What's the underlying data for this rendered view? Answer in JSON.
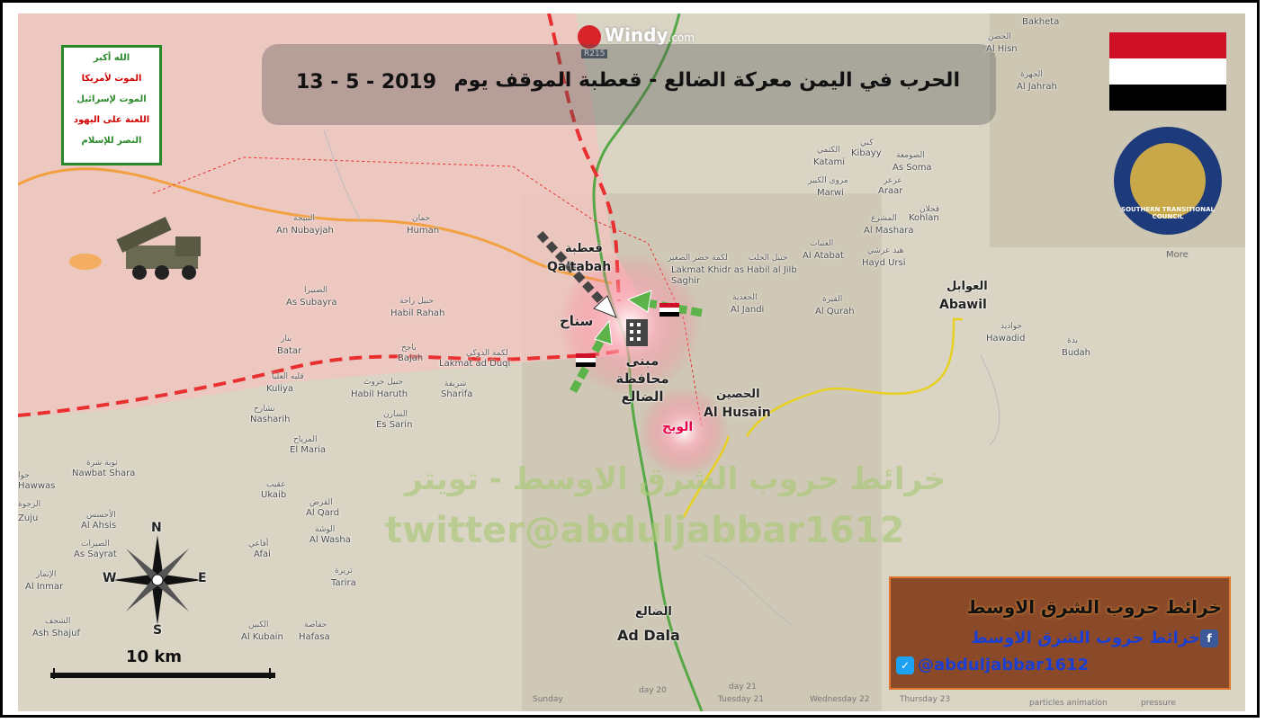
{
  "title": {
    "text": "الحرب في اليمن معركة الضالع - قعطبة الموقف يوم",
    "date": "13 - 5 - 2019"
  },
  "windy": {
    "brand": "Windy",
    "suffix": ".com",
    "road": "R215"
  },
  "slogan": [
    "الله أكبر",
    "الموت لأمريكا",
    "الموت لإسرائيل",
    "اللعنة على اليهود",
    "النصر للإسلام"
  ],
  "stc": {
    "label": "SOUTHERN TRANSITIONAL COUNCIL",
    "more": "More"
  },
  "flag_colors": [
    "#ce1126",
    "#ffffff",
    "#000000"
  ],
  "places": [
    {
      "en": "An Nubayjah",
      "ar": "النبيجة"
    },
    {
      "en": "Human",
      "ar": "حمان"
    },
    {
      "en": "Qa'tabah",
      "ar": "قعطبة"
    },
    {
      "en": "As Subayra",
      "ar": "الصبيرا"
    },
    {
      "en": "Habil Rahah",
      "ar": "حبيل راحة"
    },
    {
      "en": "Batar",
      "ar": "بتار"
    },
    {
      "en": "Bajah",
      "ar": "باجح"
    },
    {
      "en": "Lakmat ad Duqi",
      "ar": "لكمة الدوكي"
    },
    {
      "en": "Kuliya",
      "ar": "قليه العليا"
    },
    {
      "en": "Habil Haruth",
      "ar": "حبيل حروث"
    },
    {
      "en": "Sharifa",
      "ar": "شريفة"
    },
    {
      "en": "Nasharih",
      "ar": "نشارح"
    },
    {
      "en": "Es Sarin",
      "ar": "السارن"
    },
    {
      "en": "El Maria",
      "ar": "المرياح"
    },
    {
      "en": "Nawbat Shara",
      "ar": "نوبة شرة"
    },
    {
      "en": "Ukaib",
      "ar": "عقيب"
    },
    {
      "en": "Al Qard",
      "ar": "القرض"
    },
    {
      "en": "Al Washa",
      "ar": "الوشة"
    },
    {
      "en": "Al Ahsis",
      "ar": "الأحسس"
    },
    {
      "en": "As Sayrat",
      "ar": "الصيرات"
    },
    {
      "en": "Afai",
      "ar": "أفاعي"
    },
    {
      "en": "Tarira",
      "ar": "تريرة"
    },
    {
      "en": "Al Inmar",
      "ar": "الإنمار"
    },
    {
      "en": "Ash Shajuf",
      "ar": "الشجف"
    },
    {
      "en": "Al Kubain",
      "ar": "الكبين"
    },
    {
      "en": "Hafasa",
      "ar": "حفاصة"
    },
    {
      "en": "Ad Dala",
      "ar": "الضالع"
    },
    {
      "en": "Lakmat Khidr as Saghir",
      "ar": "لكمة خضر الصغير"
    },
    {
      "en": "Habil al Jilb",
      "ar": "حبيل الجلب"
    },
    {
      "en": "Al Atabat",
      "ar": "العتبات"
    },
    {
      "en": "Al Jandi",
      "ar": "الجعدية"
    },
    {
      "en": "Al Qurah",
      "ar": "القيرة"
    },
    {
      "en": "Katami",
      "ar": "الكتمي"
    },
    {
      "en": "Kibayy",
      "ar": "كبي"
    },
    {
      "en": "As Soma",
      "ar": "الصومعة"
    },
    {
      "en": "Marwi",
      "ar": "مروي الكبير"
    },
    {
      "en": "Araar",
      "ar": "عرعر"
    },
    {
      "en": "Kohlan",
      "ar": "قحلان"
    },
    {
      "en": "Al Mashara",
      "ar": "المشرع"
    },
    {
      "en": "Hayd Ursi",
      "ar": "هيد عرشي"
    },
    {
      "en": "Abawil",
      "ar": "العوابل"
    },
    {
      "en": "Hawadid",
      "ar": "حواديد"
    },
    {
      "en": "Budah",
      "ar": "بدة"
    },
    {
      "en": "Al Husain",
      "ar": "الحصين"
    },
    {
      "en": "Al Hisn",
      "ar": "الحصن"
    },
    {
      "en": "Al Jahrah",
      "ar": "الجهرة"
    },
    {
      "en": "Bakheta",
      "ar": ""
    },
    {
      "en": "Zuju",
      "ar": "الزجوة"
    },
    {
      "en": "Hawwas",
      "ar": "حوا"
    }
  ],
  "battle_labels": {
    "sinah": "سناح",
    "building": "مبنى محافظة الضالع",
    "wabh": "الوبح"
  },
  "watermark": {
    "line1": "خرائط حروب الشرق الاوسط - تويتر",
    "line2": "twitter@abduljabbar1612"
  },
  "scale": {
    "label": "10  km"
  },
  "compass": {
    "n": "N",
    "s": "S",
    "e": "E",
    "w": "W"
  },
  "brand": {
    "line1": "خرائط حروب الشرق الاوسط",
    "line2": "خرائط حروب الشرق الاوسط",
    "line3": "@abduljabbar1612"
  },
  "timeline": {
    "days": [
      "Sunday",
      "day 20",
      "Tuesday 21",
      "Wednesday 22",
      "Thursday 23",
      "day 21"
    ],
    "controls": [
      "particles animation",
      "pressure"
    ]
  }
}
